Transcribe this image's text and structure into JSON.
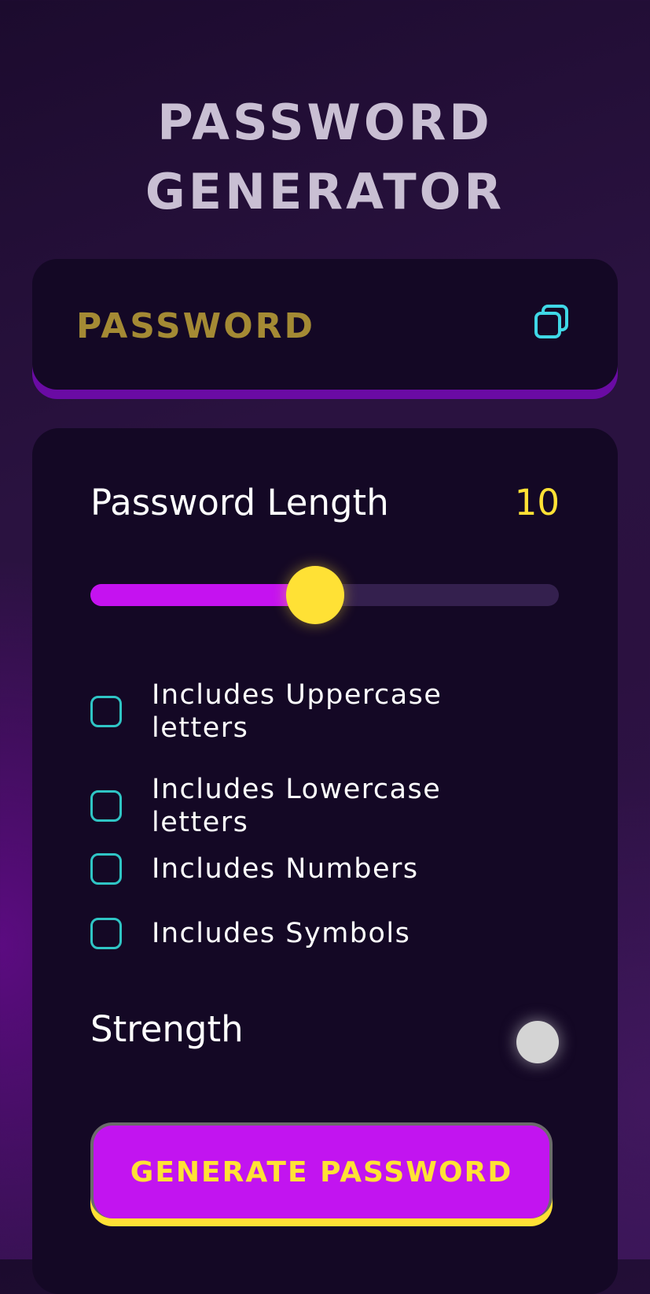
{
  "header": {
    "title_line1": "PASSWORD",
    "title_line2": "GENERATOR"
  },
  "password_display": {
    "value": "PASSWORD",
    "copy_icon": "copy-icon"
  },
  "length": {
    "label": "Password Length",
    "value": "10",
    "slider_fraction": 0.48
  },
  "options": [
    {
      "label": "Includes Uppercase letters",
      "checked": false
    },
    {
      "label": "Includes Lowercase letters",
      "checked": false
    },
    {
      "label": "Includes Numbers",
      "checked": false
    },
    {
      "label": "Includes Symbols",
      "checked": false
    }
  ],
  "strength": {
    "label": "Strength",
    "indicator_color": "#d4d4d4"
  },
  "generate": {
    "label": "GENERATE PASSWORD"
  },
  "colors": {
    "accent_purple": "#c214f0",
    "accent_yellow": "#ffe135",
    "checkbox_teal": "#2fc5c5",
    "password_gold": "#a48a34",
    "card_bg": "#140825"
  }
}
